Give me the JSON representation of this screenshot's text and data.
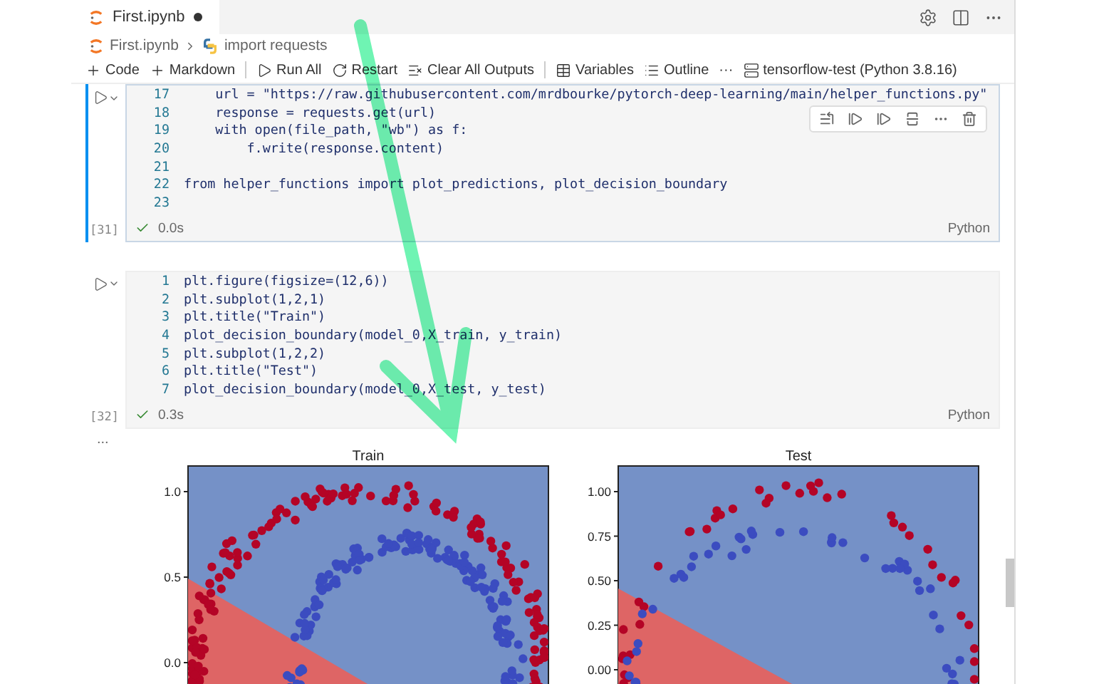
{
  "tab": {
    "title": "First.ipynb",
    "dirty": true
  },
  "actions": [
    {
      "kind": "settings"
    },
    {
      "kind": "split"
    },
    {
      "kind": "more"
    }
  ],
  "breadcrumb": [
    {
      "kind": "notebook",
      "label": "First.ipynb"
    },
    {
      "kind": "python",
      "label": "import requests"
    }
  ],
  "toolbar": [
    {
      "kind": "plus",
      "label": "Code"
    },
    {
      "kind": "plus",
      "label": "Markdown"
    },
    {
      "kind": "run",
      "label": "Run All"
    },
    {
      "kind": "restart",
      "label": "Restart"
    },
    {
      "kind": "clear",
      "label": "Clear All Outputs"
    },
    {
      "kind": "variables",
      "label": "Variables"
    },
    {
      "kind": "outline",
      "label": "Outline"
    },
    {
      "kind": "more",
      "label": "···"
    },
    {
      "kind": "kernel",
      "label": "tensorflow-test (Python 3.8.16)"
    }
  ],
  "cells": [
    {
      "focused": true,
      "count": "[31]",
      "success": true,
      "time": "0.0s",
      "language": "Python",
      "lines": [
        {
          "n": "17",
          "code": "    url = \"https://raw.githubusercontent.com/mrdbourke/pytorch-deep-learning/main/helper_functions.py\""
        },
        {
          "n": "18",
          "code": "    response = requests.get(url)"
        },
        {
          "n": "19",
          "code": "    with open(file_path, \"wb\") as f:"
        },
        {
          "n": "20",
          "code": "        f.write(response.content)"
        },
        {
          "n": "21"
        },
        {
          "n": "22",
          "code": "from helper_functions import plot_predictions, plot_decision_boundary"
        },
        {
          "n": "23"
        }
      ]
    },
    {
      "focused": false,
      "count": "[32]",
      "success": true,
      "time": "0.3s",
      "language": "Python",
      "lines": [
        {
          "n": "1",
          "code": "plt.figure(figsize=(12,6))"
        },
        {
          "n": "2",
          "code": "plt.subplot(1,2,1)"
        },
        {
          "n": "3",
          "code": "plt.title(\"Train\")"
        },
        {
          "n": "4",
          "code": "plot_decision_boundary(model_0,X_train, y_train)"
        },
        {
          "n": "5",
          "code": "plt.subplot(1,2,2)"
        },
        {
          "n": "6",
          "code": "plt.title(\"Test\")"
        },
        {
          "n": "7",
          "code": "plot_decision_boundary(model_0,X_test, y_test)"
        }
      ]
    }
  ],
  "output": {
    "more": "...",
    "plots": [
      {
        "title": "Train",
        "yticks": [
          "1.0",
          "0.5",
          "0.0"
        ]
      },
      {
        "title": "Test",
        "yticks": [
          "1.00",
          "0.75",
          "0.50",
          "0.25",
          "0.00"
        ]
      }
    ]
  }
}
